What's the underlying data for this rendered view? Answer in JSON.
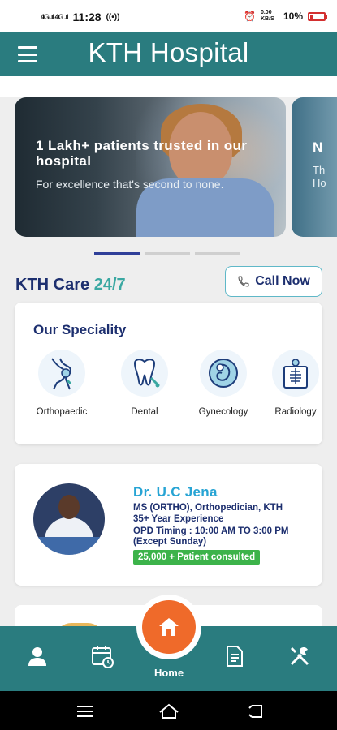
{
  "status_bar": {
    "time": "11:28",
    "signal_left": "4G .ıl 4G .ıl",
    "network_info": "0.00 KB/S",
    "battery": "10%",
    "icons": [
      "signal-icon",
      "signal-icon",
      "nfc-icon",
      "alarm-icon",
      "volte-icon",
      "battery-icon"
    ]
  },
  "header": {
    "title": "KTH Hospital",
    "menu_icon": "hamburger-menu-icon"
  },
  "banner": {
    "slides": [
      {
        "headline": "1 Lakh+ patients trusted in our hospital",
        "subtext": "For excellence that's second to none."
      },
      {
        "headline": "N",
        "subtext": "Th Ho"
      }
    ],
    "active_index": 0,
    "dot_count": 3
  },
  "care": {
    "title_main": "KTH Care",
    "title_accent": "24/7",
    "call_button": "Call Now"
  },
  "speciality": {
    "title": "Our Speciality",
    "items": [
      {
        "label": "Orthopaedic",
        "icon": "knee-joint-icon"
      },
      {
        "label": "Dental",
        "icon": "tooth-icon"
      },
      {
        "label": "Gynecology",
        "icon": "fetus-icon"
      },
      {
        "label": "Radiology",
        "icon": "xray-icon"
      }
    ]
  },
  "doctor": {
    "name": "Dr. U.C Jena",
    "qualification": "MS (ORTHO), Orthopedician, KTH",
    "experience": "35+ Year Experience",
    "opd_timing": "OPD Timing : 10:00 AM TO 3:00 PM",
    "opd_note": "(Except Sunday)",
    "badge": "25,000 + Patient consulted"
  },
  "bottom_nav": {
    "items": [
      {
        "icon": "profile-icon"
      },
      {
        "icon": "calendar-icon"
      },
      {
        "icon": "home-icon",
        "label": "Home"
      },
      {
        "icon": "document-icon"
      },
      {
        "icon": "tools-icon"
      }
    ]
  },
  "colors": {
    "primary_teal": "#2a7c7f",
    "navy": "#1d2f6f",
    "accent_teal": "#3aa8a2",
    "doctor_blue": "#27a4d4",
    "home_orange": "#ef6a2a",
    "badge_green": "#3cb34a"
  }
}
